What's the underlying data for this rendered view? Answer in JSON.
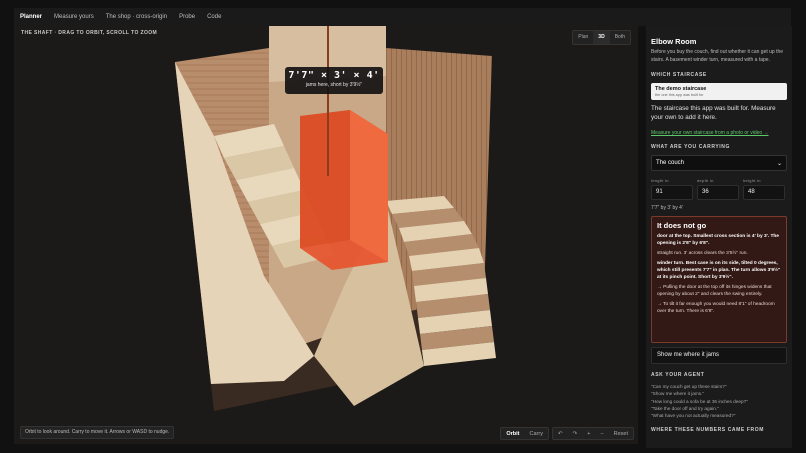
{
  "nav": {
    "tabs": [
      {
        "label": "Planner",
        "active": true
      },
      {
        "label": "Measure yours"
      },
      {
        "label": "The shop · cross-origin"
      },
      {
        "label": "Probe"
      },
      {
        "label": "Code"
      }
    ]
  },
  "viewport": {
    "caption": "The shaft · drag to orbit, scroll to zoom",
    "view_modes": [
      "Plan",
      "3D",
      "Both"
    ],
    "active_view": "3D",
    "dims_label": "7'7\" × 3' × 4'",
    "dims_sub": "jams here, short by 3'9½\"",
    "hint": "Orbit to look around. Carry to move it. Arrows or WASD to nudge.",
    "mode_buttons": [
      "Orbit",
      "Carry"
    ],
    "active_mode": "Orbit",
    "nudge_buttons": [
      "↶",
      "↷",
      "+",
      "−"
    ],
    "reset_label": "Reset",
    "colors": {
      "shaft": "#c9a888",
      "couch": "#e6542e",
      "wall_dark": "#8a6a50"
    }
  },
  "panel": {
    "title": "Elbow Room",
    "intro": "Before you buy the couch, find out whether it can get up the stairs. A basement winder turn, measured with a tape.",
    "which_staircase_title": "Which staircase",
    "demo_title": "The demo staircase",
    "demo_sub": "the one this app was built for",
    "staircase_text": "The staircase this app was built for. Measure your own to add it here.",
    "measure_link": "Measure your own staircase from a photo or video →",
    "carrying_title": "What are you carrying",
    "carry_select": "The couch",
    "fields": [
      {
        "label": "length in",
        "value": "91"
      },
      {
        "label": "depth in",
        "value": "36"
      },
      {
        "label": "height in",
        "value": "48"
      }
    ],
    "dim_readout": "7'7\" by 3' by 4'",
    "alert": {
      "title": "It does not go",
      "paras": [
        {
          "text": "door at the top. Smallest cross section is 4' by 3'. The opening is 2'8\" by 6'8\".",
          "bold": true
        },
        {
          "text": "straight run. 3' across clears the 3'5½\" run.",
          "bold": false
        },
        {
          "text": "winder turn. Best case is on its side, tilted 0 degrees, which still presents 7'7\" in plan. The turn allows 3'9½\" at its pinch point. Short by 3'9½\".",
          "bold": true
        },
        {
          "text": "→ Pulling the door at the top off its hinges widens that opening by about 2\" and clears the swing entirely.",
          "bold": false
        },
        {
          "text": "→ To tilt it far enough you would need 8'1\" of headroom over the turn. There is 6'8\".",
          "bold": false
        }
      ]
    },
    "show_button": "Show me where it jams",
    "agent_title": "Ask your agent",
    "questions": [
      "\"Can my couch get up these stairs?\"",
      "\"Show me where it jams.\"",
      "\"How long could a sofa be at 36 inches deep?\"",
      "\"Take the door off and try again.\"",
      "\"What have you not actually measured?\""
    ],
    "numbers_title": "Where these numbers came from"
  }
}
